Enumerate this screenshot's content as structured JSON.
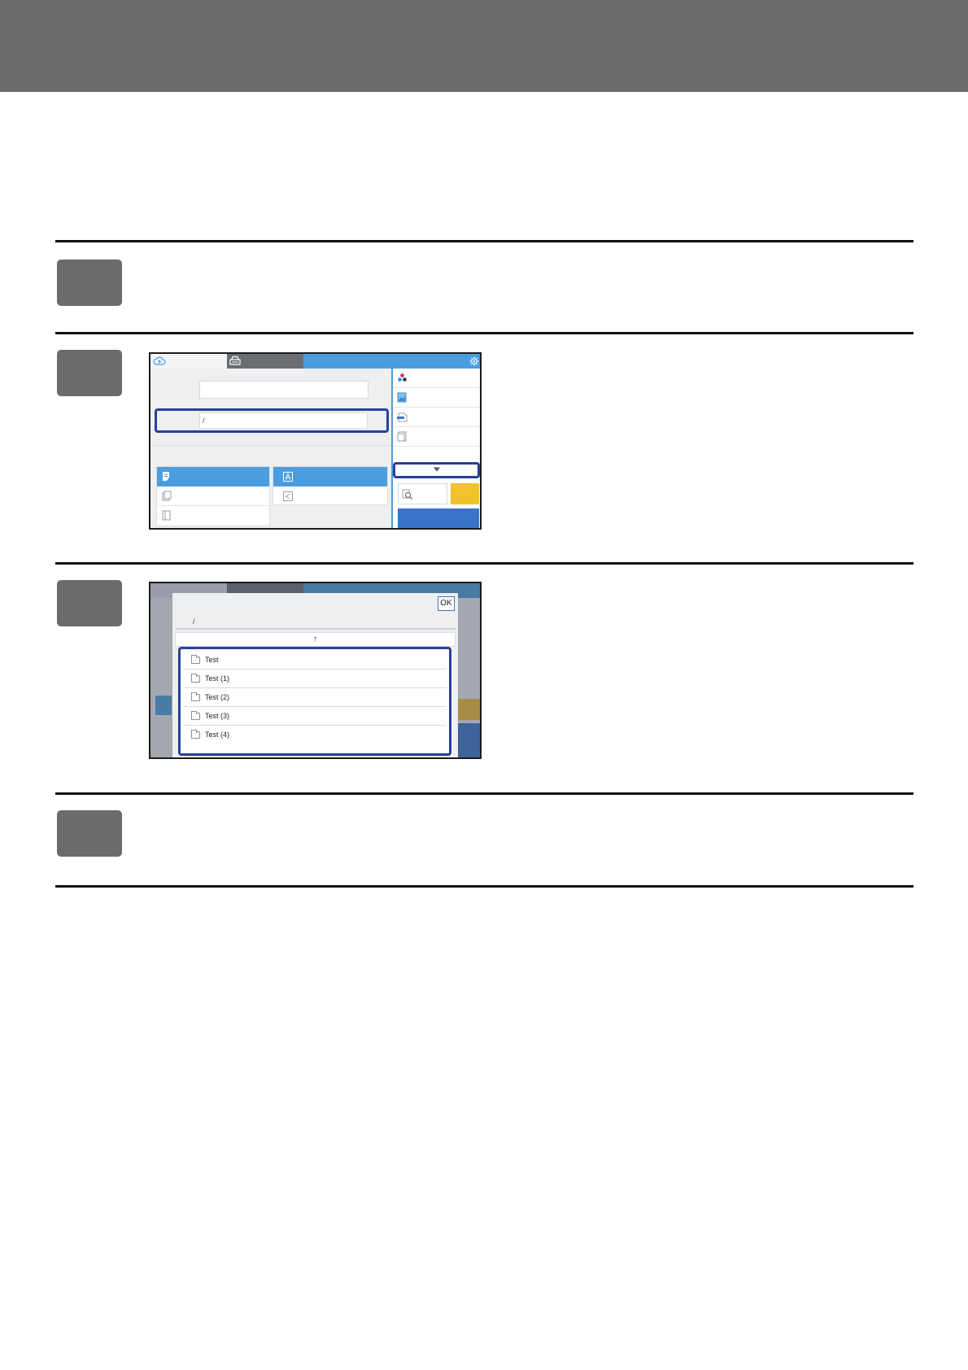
{
  "page": {
    "steps": [
      {
        "id": "step-1"
      },
      {
        "id": "step-2"
      },
      {
        "id": "step-3"
      },
      {
        "id": "step-4"
      }
    ]
  },
  "screen_main": {
    "path_separator": "/",
    "icons": [
      "cloud-upload-icon",
      "scanner-icon",
      "gear-icon",
      "color-mode-icon",
      "image-icon",
      "paper-size-icon",
      "document-icon",
      "chevron-down-icon",
      "preview-icon",
      "page-icon",
      "stack-icon",
      "binder-icon",
      "text-a-icon",
      "share-icon"
    ],
    "colors": {
      "accent": "#4a9ee0",
      "highlight": "#2a3f9b",
      "start": "#3b73c9",
      "stop": "#f2c12e"
    }
  },
  "screen_dialog": {
    "ok_label": "OK",
    "path_separator": "/",
    "up_arrow": "↑",
    "folders": [
      "Test",
      "Test (1)",
      "Test (2)",
      "Test (3)",
      "Test (4)"
    ]
  }
}
